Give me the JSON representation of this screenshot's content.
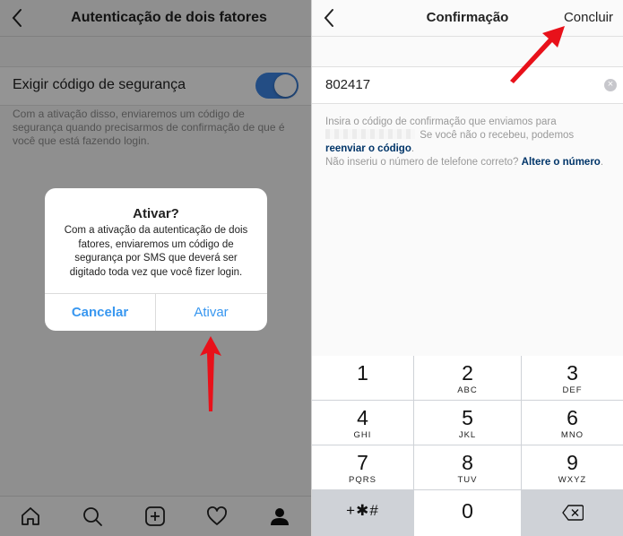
{
  "left_screen": {
    "header": {
      "title": "Autenticação de dois fatores",
      "back_icon": "chevron-left-icon"
    },
    "setting": {
      "label": "Exigir código de segurança",
      "toggle_on": true,
      "toggle_color": "#3d85e3"
    },
    "description": "Com a ativação disso, enviaremos um código de segurança quando precisarmos de confirmação de que é você que está fazendo login.",
    "dialog": {
      "title": "Ativar?",
      "message": "Com a ativação da autenticação de dois fatores, enviaremos um código de segurança por SMS que deverá ser digitado toda vez que você fizer login.",
      "cancel_label": "Cancelar",
      "activate_label": "Ativar",
      "button_color": "#3897f0"
    },
    "tabbar": {
      "icons": [
        "home-icon",
        "search-icon",
        "add-post-icon",
        "heart-icon",
        "profile-icon"
      ]
    }
  },
  "right_screen": {
    "header": {
      "title": "Confirmação",
      "done_label": "Concluir",
      "back_icon": "chevron-left-icon"
    },
    "code_input": {
      "value": "802417",
      "clear_icon": "clear-icon"
    },
    "info": {
      "line1_pre": "Insira o código de confirmação que enviamos para",
      "line1_post": " Se você não o recebeu, podemos",
      "resend_link": "reenviar o código",
      "period": ".",
      "line2_pre": "Não inseriu o número de telefone correto? ",
      "change_link": "Altere o número",
      "line2_end": "."
    },
    "keypad": {
      "keys": [
        {
          "num": "1",
          "letters": ""
        },
        {
          "num": "2",
          "letters": "ABC"
        },
        {
          "num": "3",
          "letters": "DEF"
        },
        {
          "num": "4",
          "letters": "GHI"
        },
        {
          "num": "5",
          "letters": "JKL"
        },
        {
          "num": "6",
          "letters": "MNO"
        },
        {
          "num": "7",
          "letters": "PQRS"
        },
        {
          "num": "8",
          "letters": "TUV"
        },
        {
          "num": "9",
          "letters": "WXYZ"
        }
      ],
      "symbols_label": "+✱#",
      "zero": "0",
      "delete_icon": "backspace-icon"
    }
  },
  "annotation": {
    "arrow_color": "#e8111a"
  }
}
